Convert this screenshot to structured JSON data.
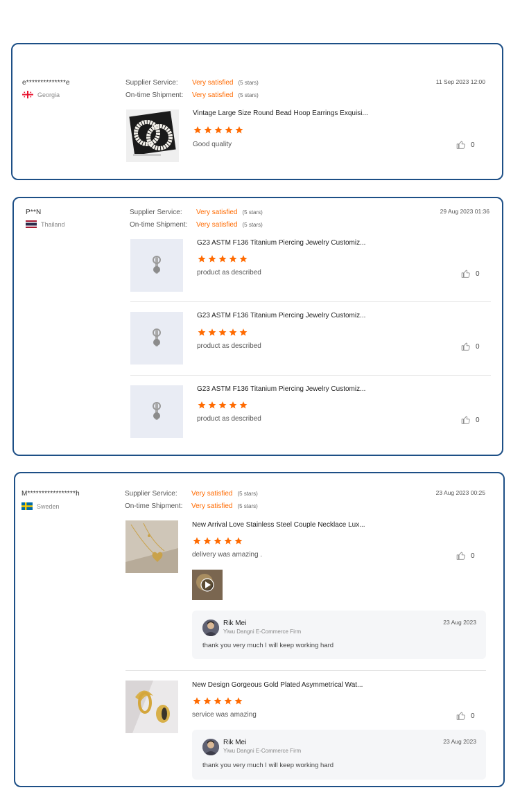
{
  "reviews": [
    {
      "user": "e**************e",
      "country": "Georgia",
      "flag": "georgia-flag",
      "supplier_service_label": "Supplier Service:",
      "supplier_service_value": "Very satisfied",
      "supplier_service_stars": "(5 stars)",
      "shipment_label": "On-time Shipment:",
      "shipment_value": "Very satisfied",
      "shipment_stars": "(5 stars)",
      "date": "11 Sep 2023 12:00",
      "items": [
        {
          "title": "Vintage Large Size Round Bead Hoop Earrings Exquisi...",
          "rating": 5,
          "comment": "Good quality",
          "likes": "0",
          "image": "pearl-hoop-earrings-image"
        }
      ]
    },
    {
      "user": "P**N",
      "country": "Thailand",
      "flag": "thailand-flag",
      "supplier_service_label": "Supplier Service:",
      "supplier_service_value": "Very satisfied",
      "supplier_service_stars": "(5 stars)",
      "shipment_label": "On-time Shipment:",
      "shipment_value": "Very satisfied",
      "shipment_stars": "(5 stars)",
      "date": "29 Aug 2023 01:36",
      "items": [
        {
          "title": "G23 ASTM F136 Titanium Piercing Jewelry Customiz...",
          "rating": 5,
          "comment": "product as described",
          "likes": "0",
          "image": "titanium-piercing-image"
        },
        {
          "title": "G23 ASTM F136 Titanium Piercing Jewelry Customiz...",
          "rating": 5,
          "comment": "product as described",
          "likes": "0",
          "image": "titanium-piercing-image"
        },
        {
          "title": "G23 ASTM F136 Titanium Piercing Jewelry Customiz...",
          "rating": 5,
          "comment": "product as described",
          "likes": "0",
          "image": "titanium-piercing-image"
        }
      ]
    },
    {
      "user": "M*****************h",
      "country": "Sweden",
      "flag": "sweden-flag",
      "supplier_service_label": "Supplier Service:",
      "supplier_service_value": "Very satisfied",
      "supplier_service_stars": "(5 stars)",
      "shipment_label": "On-time Shipment:",
      "shipment_value": "Very satisfied",
      "shipment_stars": "(5 stars)",
      "date": "23 Aug 2023 00:25",
      "items": [
        {
          "title": "New Arrival Love Stainless Steel Couple Necklace Lux...",
          "rating": 5,
          "comment": "delivery was amazing .",
          "likes": "0",
          "image": "heart-necklace-image",
          "reply": {
            "name": "Rik Mei",
            "firm": "Yiwu Dangni E-Commerce Firm",
            "date": "23 Aug 2023",
            "text": "thank you very much I will keep working hard"
          }
        },
        {
          "title": "New Design Gorgeous Gold Plated Asymmetrical Wat...",
          "rating": 5,
          "comment": "service was amazing",
          "likes": "0",
          "image": "gold-earrings-image",
          "reply": {
            "name": "Rik Mei",
            "firm": "Yiwu Dangni E-Commerce Firm",
            "date": "23 Aug 2023",
            "text": "thank you very much I will keep working hard"
          }
        }
      ]
    }
  ],
  "colors": {
    "border": "#1d4f86",
    "accent": "#ff6a00",
    "reply_bg": "#f5f6f8"
  }
}
